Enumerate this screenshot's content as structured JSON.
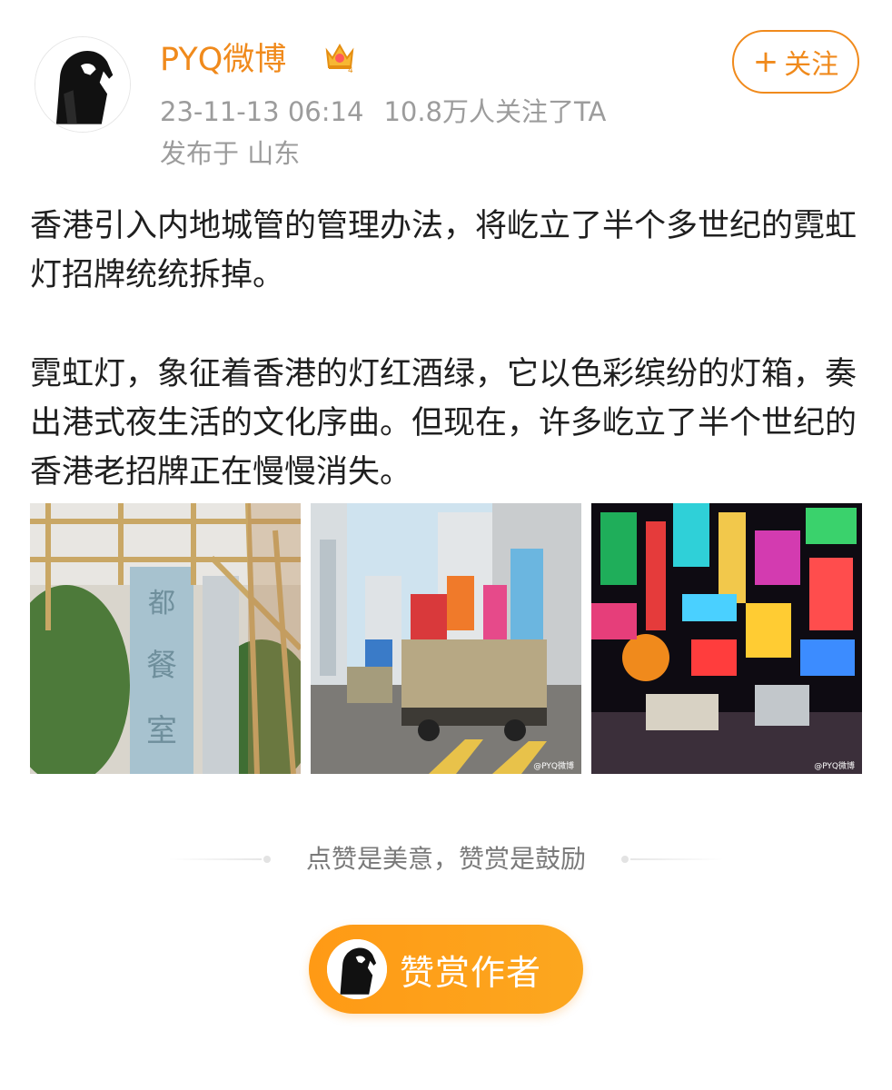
{
  "author": {
    "name": "PYQ微博",
    "badge_icon": "crown-vip-icon",
    "timestamp": "23-11-13 06:14",
    "followers": "10.8万人关注了TA",
    "location": "发布于 山东",
    "follow_label": "关注",
    "follow_icon": "plus-icon"
  },
  "post": {
    "paragraphs": [
      "香港引入内地城管的管理办法，将屹立了半个多世纪的霓虹灯招牌统统拆掉。",
      "霓虹灯，象征着香港的灯红酒绿，它以色彩缤纷的灯箱，奏出港式夜生活的文化序曲。但现在，许多屹立了半个世纪的香港老招牌正在慢慢消失。"
    ],
    "images": [
      {
        "name": "photo-sign-scaffolding",
        "sign_text": "都餐室",
        "watermark": ""
      },
      {
        "name": "photo-trucks-signs",
        "watermark": "@PYQ微博"
      },
      {
        "name": "photo-neon-street",
        "watermark": "@PYQ微博"
      }
    ]
  },
  "reward": {
    "divider_text": "点赞是美意，赞赏是鼓励",
    "button_label": "赞赏作者"
  },
  "colors": {
    "accent": "#f08a1c",
    "reward_gradient_start": "#ff9a15",
    "reward_gradient_end": "#fca71f",
    "meta_text": "#9c9c9c"
  }
}
